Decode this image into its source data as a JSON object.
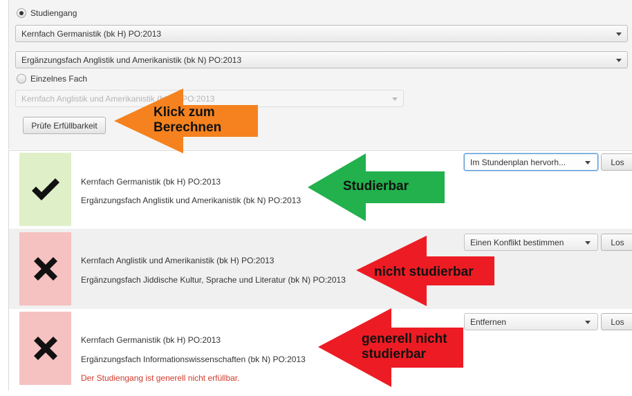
{
  "form": {
    "radio_program_label": "Studiengang",
    "major_select": "Kernfach Germanistik (bk H) PO:2013",
    "minor_select": "Ergänzungsfach Anglistik und Amerikanistik (bk N) PO:2013",
    "radio_single_label": "Einzelnes Fach",
    "single_select": "Kernfach Anglistik und Amerikanistik (bk H) PO:2013",
    "check_button": "Prüfe Erfüllbarkeit"
  },
  "results": [
    {
      "status": "ok",
      "color": "#dff0c8",
      "line1": "Kernfach Germanistik (bk H) PO:2013",
      "line2": "Ergänzungsfach Anglistik und Amerikanistik (bk N) PO:2013",
      "error": "",
      "action_select": "Im Stundenplan hervorh...",
      "go_button": "Los"
    },
    {
      "status": "fail",
      "color": "#f6c1c1",
      "line1": "Kernfach Anglistik und Amerikanistik (bk H) PO:2013",
      "line2": "Ergänzungsfach Jiddische Kultur, Sprache und Literatur (bk N) PO:2013",
      "error": "",
      "action_select": "Einen Konflikt bestimmen",
      "go_button": "Los"
    },
    {
      "status": "fail",
      "color": "#f6c1c1",
      "line1": "Kernfach Germanistik (bk H) PO:2013",
      "line2": "Ergänzungsfach Informationswissenschaften (bk N) PO:2013",
      "error": "Der Studiengang ist generell nicht erfüllbar.",
      "action_select": "Entfernen",
      "go_button": "Los"
    }
  ],
  "annotations": {
    "click_label": "Klick zum Berechnen",
    "studierbar": "Studierbar",
    "nicht_studierbar": "nicht studierbar",
    "generell": "generell nicht studierbar",
    "colors": {
      "orange": "#f5821f",
      "green": "#22b14c",
      "red": "#ed1c24"
    }
  }
}
